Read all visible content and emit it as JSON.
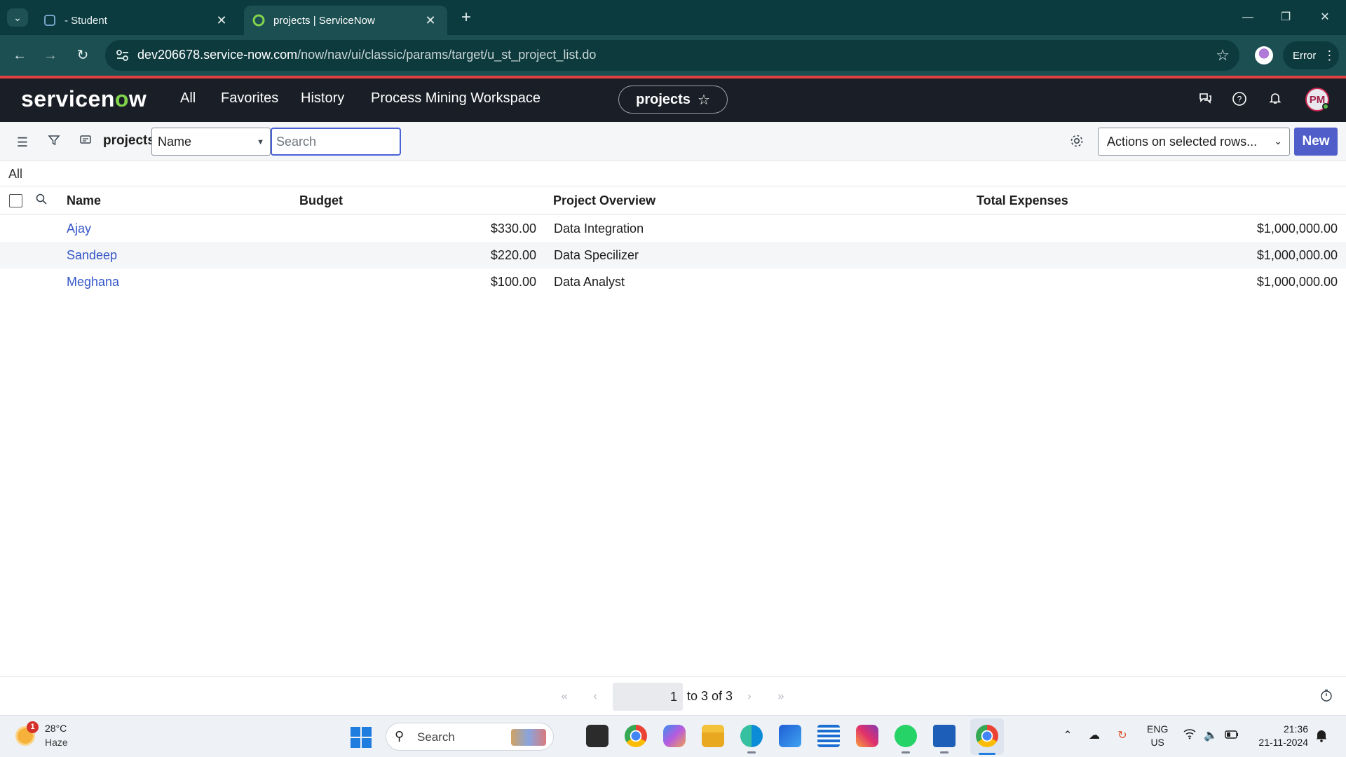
{
  "browser": {
    "tabs": [
      {
        "title": "- Student",
        "active": false
      },
      {
        "title": "projects | ServiceNow",
        "active": true
      }
    ],
    "url_host": "dev206678.service-now.com",
    "url_path": "/now/nav/ui/classic/params/target/u_st_project_list.do",
    "profile_status": "Error"
  },
  "sn_header": {
    "logo_text_1": "servicen",
    "logo_o": "o",
    "logo_text_2": "w",
    "nav": [
      "All",
      "Favorites",
      "History",
      "Process Mining Workspace"
    ],
    "context_label": "projects",
    "user_initials": "PM"
  },
  "toolbar": {
    "list_title": "projects",
    "field_select": "Name",
    "search_placeholder": "Search",
    "actions_select": "Actions on selected rows...",
    "new_label": "New"
  },
  "breadcrumb": "All",
  "table": {
    "columns": [
      "Name",
      "Budget",
      "Project Overview",
      "Total Expenses"
    ],
    "rows": [
      {
        "name": "Ajay",
        "budget": "$330.00",
        "overview": "Data Integration",
        "expenses": "$1,000,000.00"
      },
      {
        "name": "Sandeep",
        "budget": "$220.00",
        "overview": "Data Specilizer",
        "expenses": "$1,000,000.00"
      },
      {
        "name": "Meghana",
        "budget": "$100.00",
        "overview": "Data Analyst",
        "expenses": "$1,000,000.00"
      }
    ]
  },
  "pagination": {
    "current": "1",
    "range": "to 3 of 3"
  },
  "taskbar": {
    "weather_badge": "1",
    "temperature": "28°C",
    "condition": "Haze",
    "search_label": "Search",
    "lang_1": "ENG",
    "lang_2": "US",
    "time": "21:36",
    "date": "21-11-2024"
  },
  "colors": {
    "browser_bg": "#0b3b3e",
    "sn_header": "#1a1e26",
    "accent_red": "#e04040",
    "link_blue": "#3556c8",
    "new_button": "#4f5ec8",
    "logo_green": "#81d44b"
  }
}
